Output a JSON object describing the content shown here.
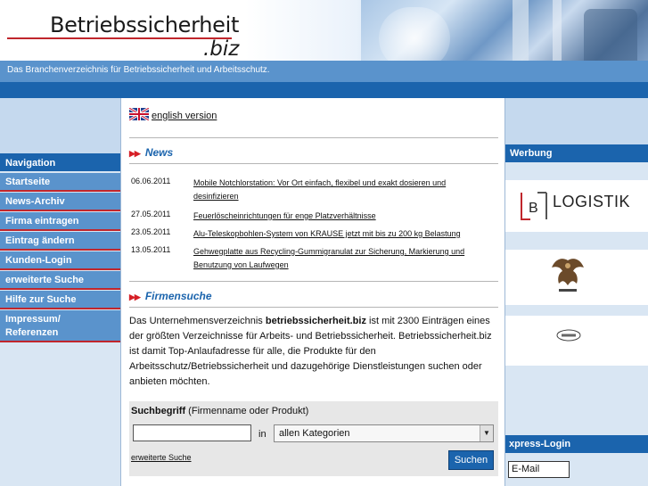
{
  "header": {
    "logo_title": "Betriebssicherheit",
    "logo_suffix": ".biz",
    "tagline": "Das Branchenverzeichnis für Betriebssicherheit und Arbeitsschutz."
  },
  "sidebar": {
    "heading": "Navigation",
    "items": [
      {
        "label": "Startseite"
      },
      {
        "label": "News-Archiv"
      },
      {
        "label": "Firma eintragen"
      },
      {
        "label": "Eintrag ändern"
      },
      {
        "label": "Kunden-Login"
      },
      {
        "label": "erweiterte Suche"
      },
      {
        "label": "Hilfe zur Suche"
      },
      {
        "label": "Impressum/ Referenzen"
      }
    ]
  },
  "main": {
    "language_link": "english version",
    "news": {
      "heading": "News",
      "items": [
        {
          "date": "06.06.2011",
          "text": "Mobile Notchlorstation: Vor Ort einfach, flexibel und exakt dosieren und desinfizieren"
        },
        {
          "date": "27.05.2011",
          "text": "Feuerlöscheinrichtungen für enge Platzverhältnisse"
        },
        {
          "date": "23.05.2011",
          "text": "Alu-Teleskopbohlen-System von KRAUSE jetzt mit bis zu 200 kg Belastung"
        },
        {
          "date": "13.05.2011",
          "text": "Gehwegplatte aus Recycling-Gummigranulat zur Sicherung, Markierung und Benutzung von Laufwegen"
        }
      ]
    },
    "firmensuche": {
      "heading": "Firmensuche",
      "intro_before": "Das Unternehmensverzeichnis ",
      "intro_bold": "betriebssicherheit.biz",
      "intro_after": " ist mit 2300 Einträgen eines der größten Verzeichnisse für Arbeits- und Betriebssicherheit. Betriebssicherheit.biz ist damit Top-Anlaufadresse für alle, die Produkte für den Arbeitsschutz/Betriebssicherheit und dazugehörige Dienstleistungen suchen oder anbieten möchten.",
      "search_label_bold": "Suchbegriff",
      "search_label_rest": " (Firmenname oder Produkt)",
      "search_value": "",
      "in_label": "in",
      "category_selected": "allen Kategorien",
      "advanced_link": "erweiterte Suche",
      "search_button": "Suchen"
    }
  },
  "right_sidebar": {
    "ads_heading": "Werbung",
    "ad1_text": "LOGISTIK",
    "ad1_mark": "B",
    "express_heading": "xpress-Login",
    "email_placeholder": "E-Mail"
  },
  "colors": {
    "brand_blue": "#1b64ad",
    "nav_blue": "#5a93cc",
    "accent_red": "#c0262c",
    "link_heading": "#1b64ad"
  },
  "icons": {
    "flag": "uk-flag-icon",
    "section_marker": "double-arrow-icon",
    "dropdown": "chevron-down-icon"
  }
}
